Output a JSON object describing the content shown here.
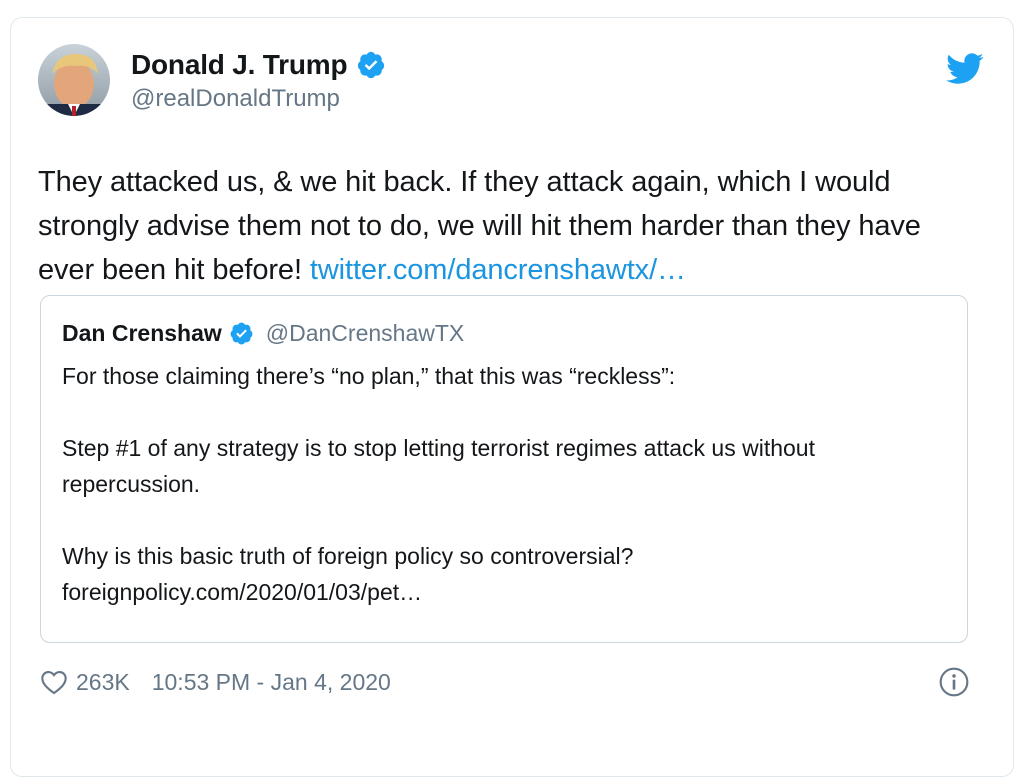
{
  "tweet": {
    "author": {
      "display_name": "Donald J. Trump",
      "handle": "@realDonaldTrump",
      "verified": true
    },
    "text_main": "They attacked us, & we hit back. If they attack again, which I would strongly advise them not to do, we will hit them harder than they have ever been hit before! ",
    "link_text": "twitter.com/dancrenshawtx/…",
    "likes": "263K",
    "timestamp": "10:53 PM - Jan 4, 2020"
  },
  "quoted_tweet": {
    "author": {
      "display_name": "Dan Crenshaw",
      "handle": "@DanCrenshawTX",
      "verified": true
    },
    "paragraphs": [
      "For those claiming there’s “no plan,” that this was “reckless”:",
      "Step #1 of any strategy is to stop letting terrorist regimes attack us without repercussion.",
      "Why is this basic truth of foreign policy so controversial?foreignpolicy.com/2020/01/03/pet…"
    ]
  },
  "colors": {
    "link": "#1b95e0",
    "verified": "#1da1f2",
    "twitter_bird": "#1da1f2",
    "secondary_text": "#657786",
    "border": "#e1e8ed"
  },
  "icons": {
    "brand": "twitter-bird-icon",
    "verified": "verified-badge-icon",
    "like": "heart-icon",
    "info": "info-icon"
  }
}
